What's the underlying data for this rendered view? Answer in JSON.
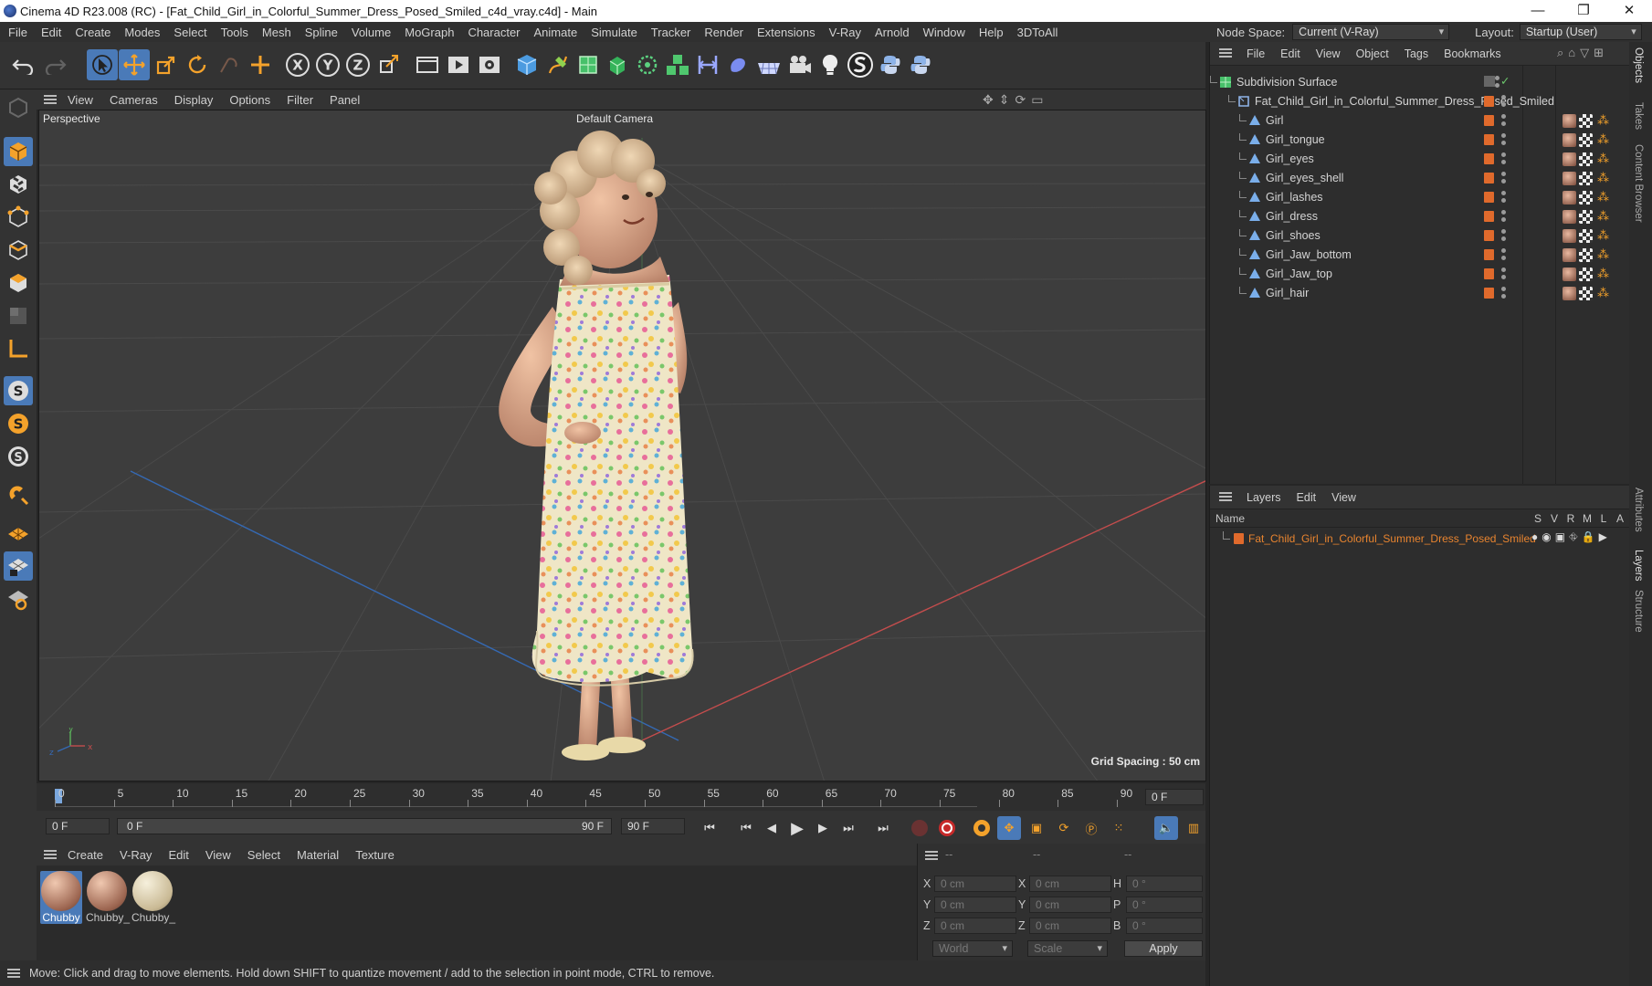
{
  "window": {
    "title": "Cinema 4D R23.008 (RC) - [Fat_Child_Girl_in_Colorful_Summer_Dress_Posed_Smiled_c4d_vray.c4d] - Main"
  },
  "menubar": [
    "File",
    "Edit",
    "Create",
    "Modes",
    "Select",
    "Tools",
    "Mesh",
    "Spline",
    "Volume",
    "MoGraph",
    "Character",
    "Animate",
    "Simulate",
    "Tracker",
    "Render",
    "Extensions",
    "V-Ray",
    "Arnold",
    "Window",
    "Help",
    "3DToAll"
  ],
  "nodespace": {
    "label": "Node Space:",
    "value": "Current (V-Ray)",
    "layout_label": "Layout:",
    "layout_value": "Startup (User)"
  },
  "viewport": {
    "menu": [
      "View",
      "Cameras",
      "Display",
      "Options",
      "Filter",
      "Panel"
    ],
    "name": "Perspective",
    "camera": "Default Camera",
    "grid_spacing": "Grid Spacing : 50 cm"
  },
  "objects": {
    "menu": [
      "File",
      "Edit",
      "View",
      "Object",
      "Tags",
      "Bookmarks"
    ],
    "root": "Subdivision Surface",
    "group": "Fat_Child_Girl_in_Colorful_Summer_Dress_Posed_Smiled",
    "children": [
      "Girl",
      "Girl_tongue",
      "Girl_eyes",
      "Girl_eyes_shell",
      "Girl_lashes",
      "Girl_dress",
      "Girl_shoes",
      "Girl_Jaw_bottom",
      "Girl_Jaw_top",
      "Girl_hair"
    ]
  },
  "layers": {
    "menu": [
      "Layers",
      "Edit",
      "View"
    ],
    "col_name": "Name",
    "cols": [
      "S",
      "V",
      "R",
      "M",
      "L",
      "A"
    ],
    "layer": "Fat_Child_Girl_in_Colorful_Summer_Dress_Posed_Smiled"
  },
  "timeline": {
    "ticks": [
      "0",
      "5",
      "10",
      "15",
      "20",
      "25",
      "30",
      "35",
      "40",
      "45",
      "50",
      "55",
      "60",
      "65",
      "70",
      "75",
      "80",
      "85",
      "90"
    ],
    "current": "0 F",
    "start": "0 F",
    "range_start": "0 F",
    "range_end": "90 F",
    "end": "90 F"
  },
  "materials": {
    "menu": [
      "Create",
      "V-Ray",
      "Edit",
      "View",
      "Select",
      "Material",
      "Texture"
    ],
    "items": [
      "Chubby",
      "Chubby_",
      "Chubby_"
    ]
  },
  "coords": {
    "hdr1": "--",
    "hdr2": "--",
    "hdr3": "--",
    "x": "0 cm",
    "y": "0 cm",
    "z": "0 cm",
    "sx": "0 cm",
    "sy": "0 cm",
    "sz": "0 cm",
    "h": "0 °",
    "p": "0 °",
    "b": "0 °",
    "mode": "World",
    "scale": "Scale",
    "apply": "Apply"
  },
  "sidetabs": [
    "Objects",
    "Takes",
    "Content Browser",
    "Attributes",
    "Layers",
    "Structure"
  ],
  "status": "Move: Click and drag to move elements. Hold down SHIFT to quantize movement / add to the selection in point mode, CTRL to remove."
}
